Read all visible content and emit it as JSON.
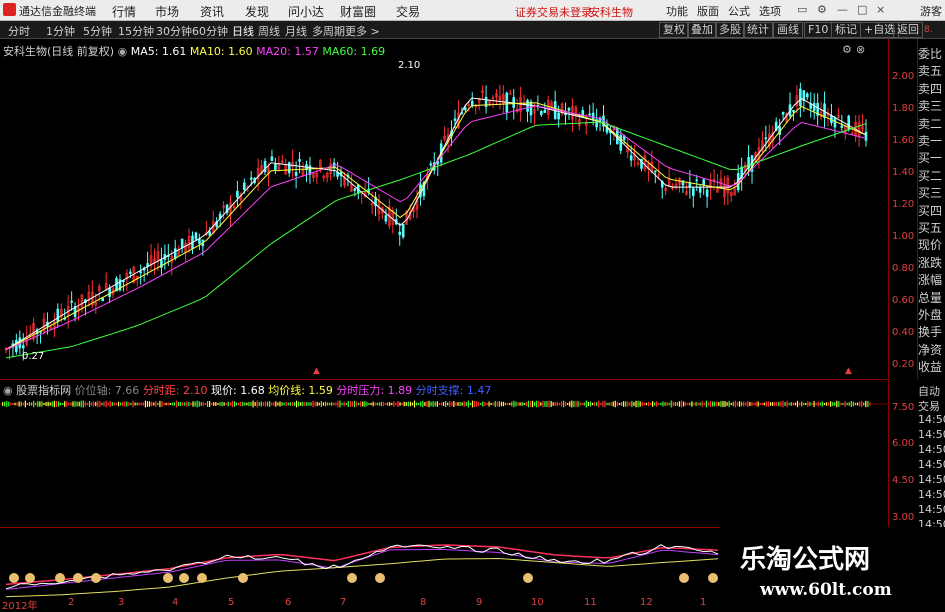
{
  "app_title": "通达信金融终端",
  "menu": [
    "行情",
    "市场",
    "资讯",
    "发现",
    "问小达",
    "财富圈",
    "交易"
  ],
  "status_link": "证券交易未登录",
  "stock_link": "安科生物",
  "right_menu": [
    "功能",
    "版面",
    "公式",
    "选项"
  ],
  "guest_label": "游客",
  "periods": [
    "分时",
    "1分钟",
    "5分钟",
    "15分钟",
    "30分钟",
    "60分钟",
    "日线",
    "周线",
    "月线",
    "多周期",
    "更多 >"
  ],
  "active_period": "日线",
  "toolbar_buttons": [
    "复权",
    "叠加",
    "多股",
    "统计",
    "画线",
    "F10",
    "标记",
    "+自选",
    "返回"
  ],
  "main_legend": {
    "title": "安科生物(日线 前复权)",
    "ma5": "MA5: 1.61",
    "ma10": "MA10: 1.60",
    "ma20": "MA20: 1.57",
    "ma60": "MA60: 1.69"
  },
  "annotations": {
    "high": "2.10",
    "low": "0.27"
  },
  "price_axis": [
    "2.00",
    "1.80",
    "1.60",
    "1.40",
    "1.20",
    "1.00",
    "0.80",
    "0.60",
    "0.40",
    "0.20"
  ],
  "sub_legend": {
    "title": "股票指标网",
    "a": "价位轴: 7.66",
    "b": "分时距: 2.10",
    "c": "现价: 1.68",
    "d": "均价线: 1.59",
    "e": "分时压力: 1.89",
    "f": "分时支撑: 1.47"
  },
  "sub_axis": [
    "7.50",
    "6.00",
    "4.50",
    "3.00"
  ],
  "x_axis": [
    "2012年",
    "2",
    "3",
    "4",
    "5",
    "6",
    "7",
    "8",
    "9",
    "10",
    "11",
    "12",
    "1"
  ],
  "side_panel": [
    "委比",
    "卖五",
    "卖四",
    "卖三",
    "卖二",
    "卖一",
    "买一",
    "买二",
    "买三",
    "买四",
    "买五",
    "现价",
    "涨跌",
    "涨幅",
    "总量",
    "外盘",
    "换手",
    "净资",
    "收益"
  ],
  "side_top": "8.",
  "side_lower": [
    "自动",
    "交易",
    "14:50",
    "14:50",
    "14:50",
    "14:50",
    "14:50",
    "14:50",
    "14:50",
    "14:50"
  ],
  "watermark": {
    "line1": "乐淘公式网",
    "line2": "www.60lt.com"
  },
  "colors": {
    "ma5": "#ffffff",
    "ma10": "#ffff40",
    "ma20": "#ff40ff",
    "ma60": "#40ff40",
    "up": "#ff3030",
    "down": "#54ffff",
    "axis": "#e04040"
  },
  "chart_data": {
    "type": "line",
    "title": "安科生物(日线 前复权)",
    "ylim": [
      0.2,
      2.1
    ],
    "x": [
      "2012年",
      "2",
      "3",
      "4",
      "5",
      "6",
      "7",
      "8",
      "9",
      "10",
      "11",
      "12",
      "1"
    ],
    "series": [
      {
        "name": "MA5",
        "values": [
          0.3,
          0.55,
          0.78,
          1.0,
          1.45,
          1.4,
          1.05,
          1.85,
          1.8,
          1.7,
          1.3,
          1.3,
          1.85,
          1.62
        ]
      },
      {
        "name": "MA10",
        "values": [
          0.3,
          0.52,
          0.74,
          0.96,
          1.4,
          1.42,
          1.1,
          1.8,
          1.82,
          1.7,
          1.35,
          1.28,
          1.8,
          1.62
        ]
      },
      {
        "name": "MA20",
        "values": [
          0.3,
          0.48,
          0.68,
          0.9,
          1.3,
          1.44,
          1.2,
          1.7,
          1.8,
          1.72,
          1.42,
          1.3,
          1.7,
          1.6
        ]
      },
      {
        "name": "MA60",
        "values": [
          0.25,
          0.32,
          0.45,
          0.62,
          0.95,
          1.22,
          1.35,
          1.5,
          1.68,
          1.7,
          1.55,
          1.4,
          1.55,
          1.69
        ]
      }
    ]
  }
}
